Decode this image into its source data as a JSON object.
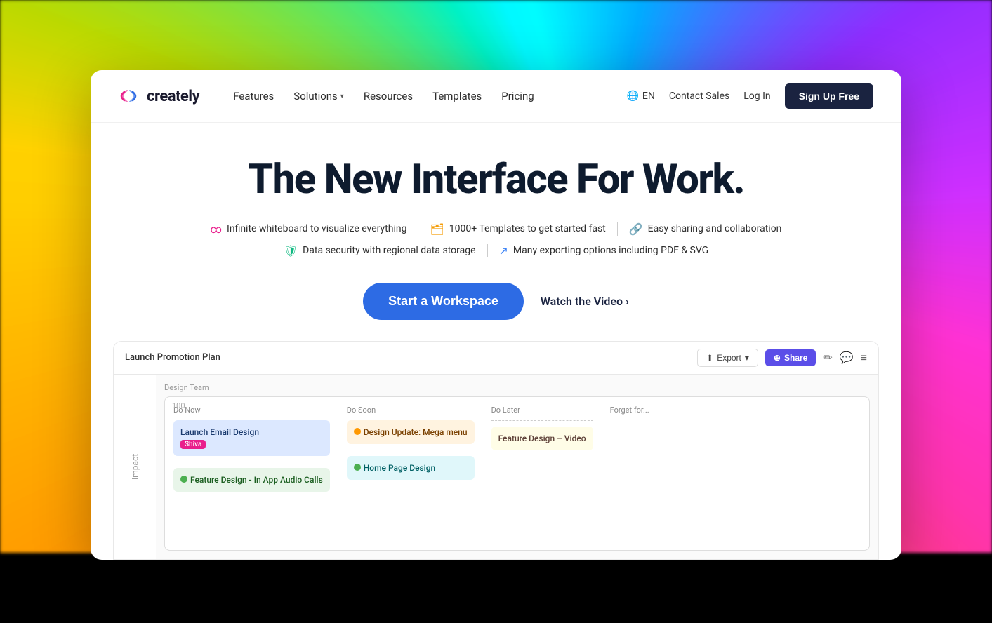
{
  "background": {},
  "navbar": {
    "logo_text": "creately",
    "nav_items": [
      {
        "label": "Features",
        "has_dropdown": false
      },
      {
        "label": "Solutions",
        "has_dropdown": true
      },
      {
        "label": "Resources",
        "has_dropdown": false
      },
      {
        "label": "Templates",
        "has_dropdown": false
      },
      {
        "label": "Pricing",
        "has_dropdown": false
      }
    ],
    "lang": "EN",
    "contact_sales": "Contact Sales",
    "login": "Log In",
    "signup": "Sign Up Free"
  },
  "hero": {
    "title": "The New Interface For Work.",
    "features_row1": [
      {
        "icon": "∞",
        "icon_color": "#e91e8c",
        "text": "Infinite whiteboard to visualize everything"
      },
      {
        "icon": "🗂",
        "icon_color": "#f59e0b",
        "text": "1000+ Templates to get started fast"
      },
      {
        "icon": "🔗",
        "icon_color": "#8b5cf6",
        "text": "Easy sharing and collaboration"
      }
    ],
    "features_row2": [
      {
        "icon": "🛡",
        "icon_color": "#10b981",
        "text": "Data security with regional data storage"
      },
      {
        "icon": "↗",
        "icon_color": "#3b82f6",
        "text": "Many exporting options including PDF & SVG"
      }
    ],
    "cta_primary": "Start a Workspace",
    "cta_secondary": "Watch the Video"
  },
  "demo": {
    "toolbar_title": "Launch Promotion Plan",
    "export_label": "Export",
    "share_label": "Share",
    "panel_label": "Design Team",
    "kanban": {
      "cols": [
        {
          "header": "Do Now",
          "cards": [
            {
              "title": "Launch Email Design",
              "style": "blue",
              "tag": "Shiva"
            },
            {
              "title": "Feature Design - In App Audio Calls",
              "style": "green",
              "dot": "green"
            }
          ]
        },
        {
          "header": "Do Soon",
          "cards": [
            {
              "title": "Design Update: Mega menu",
              "style": "orange",
              "dot": "orange"
            },
            {
              "title": "Home Page Design",
              "style": "teal",
              "dot": "green"
            }
          ]
        },
        {
          "header": "Do Later",
          "cards": [
            {
              "title": "Feature Design – Video",
              "style": "yellow"
            }
          ]
        },
        {
          "header": "Forget for now",
          "cards": []
        }
      ]
    },
    "y_axis_label": "Impact",
    "x_axis_label": "100"
  }
}
